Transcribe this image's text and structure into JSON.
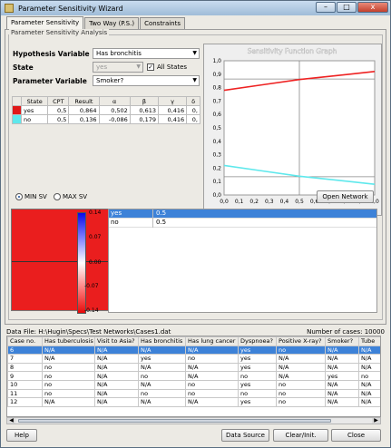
{
  "window": {
    "title": "Parameter Sensitivity Wizard",
    "close_label": "x"
  },
  "tabs": [
    {
      "label": "Parameter Sensitivity",
      "active": true
    },
    {
      "label": "Two Way (P.S.)",
      "active": false
    },
    {
      "label": "Constraints",
      "active": false
    }
  ],
  "group_title": "Parameter Sensitivity Analysis",
  "hypothesis": {
    "label": "Hypothesis Variable",
    "value": "Has bronchitis"
  },
  "state": {
    "label": "State",
    "value": "yes",
    "all_states_label": "All States",
    "all_states_checked": true
  },
  "parameter": {
    "label": "Parameter Variable",
    "value": "Smoker?"
  },
  "sv_table": {
    "headers": [
      "State",
      "CPT",
      "Result",
      "α",
      "β",
      "γ",
      "δ"
    ],
    "rows": [
      {
        "swatch": "#e01818",
        "state": "yes",
        "cpt": "0,5",
        "result": "0,864",
        "alpha": "0,502",
        "beta": "0,613",
        "gamma": "0,416",
        "delta": "0,"
      },
      {
        "swatch": "#5ee8ec",
        "state": "no",
        "cpt": "0,5",
        "result": "0,136",
        "alpha": "-0,086",
        "beta": "0,179",
        "gamma": "0,416",
        "delta": "0,"
      }
    ]
  },
  "graph": {
    "title": "Sensitivity Function Graph",
    "yticks": [
      "1,0",
      "0,9",
      "0,8",
      "0,7",
      "0,6",
      "0,5",
      "0,4",
      "0,3",
      "0,2",
      "0,1",
      "0,0"
    ],
    "xticks": [
      "0,0",
      "0,1",
      "0,2",
      "0,3",
      "0,4",
      "0,5",
      "0,6",
      "0,7",
      "0,8",
      "0,9",
      "1,0"
    ]
  },
  "chart_data": {
    "type": "line",
    "title": "Sensitivity Function Graph",
    "xlim": [
      0,
      1
    ],
    "ylim": [
      0,
      1
    ],
    "series": [
      {
        "color": "#ee2222",
        "x": [
          0,
          0.25,
          0.5,
          0.75,
          1.0
        ],
        "y": [
          0.78,
          0.82,
          0.86,
          0.89,
          0.92
        ]
      },
      {
        "color": "#5ee8ec",
        "x": [
          0,
          0.25,
          0.5,
          0.75,
          1.0
        ],
        "y": [
          0.22,
          0.18,
          0.14,
          0.11,
          0.08
        ]
      }
    ],
    "marker_x": 0.5,
    "marker_y": [
      0.864,
      0.136
    ]
  },
  "sv_mode": {
    "min_label": "MIN SV",
    "max_label": "MAX SV",
    "selected": "min"
  },
  "open_network_label": "Open Network",
  "colorbar_ticks": [
    "0.14",
    "0.07",
    "0.00",
    "-0.07",
    "-0.14"
  ],
  "value_rows": [
    {
      "state": "yes",
      "value": "0.5",
      "selected": true
    },
    {
      "state": "no",
      "value": "0.5",
      "selected": false
    }
  ],
  "data_file": {
    "label": "Data File: H:\\Hugin\\Specs\\Test Networks\\Cases1.dat",
    "cases": "Number of cases: 10000"
  },
  "data_table": {
    "headers": [
      "Case no.",
      "Has tuberculosis",
      "Visit to Asia?",
      "Has bronchitis",
      "Has lung cancer",
      "Dyspnoea?",
      "Positive X-ray?",
      "Smoker?",
      "Tube"
    ],
    "rows": [
      [
        "6",
        "N/A",
        "N/A",
        "N/A",
        "N/A",
        "yes",
        "no",
        "N/A",
        "N/A"
      ],
      [
        "7",
        "N/A",
        "N/A",
        "yes",
        "no",
        "yes",
        "N/A",
        "N/A",
        "N/A"
      ],
      [
        "8",
        "no",
        "N/A",
        "N/A",
        "N/A",
        "yes",
        "N/A",
        "N/A",
        "N/A"
      ],
      [
        "9",
        "no",
        "N/A",
        "no",
        "N/A",
        "no",
        "N/A",
        "yes",
        "no"
      ],
      [
        "10",
        "no",
        "N/A",
        "N/A",
        "no",
        "yes",
        "no",
        "N/A",
        "N/A"
      ],
      [
        "11",
        "no",
        "N/A",
        "no",
        "no",
        "no",
        "no",
        "N/A",
        "N/A"
      ],
      [
        "12",
        "N/A",
        "N/A",
        "N/A",
        "N/A",
        "yes",
        "no",
        "N/A",
        "N/A"
      ]
    ]
  },
  "buttons": {
    "help": "Help",
    "data_source": "Data Source",
    "clear": "Clear/Init.",
    "close": "Close"
  }
}
